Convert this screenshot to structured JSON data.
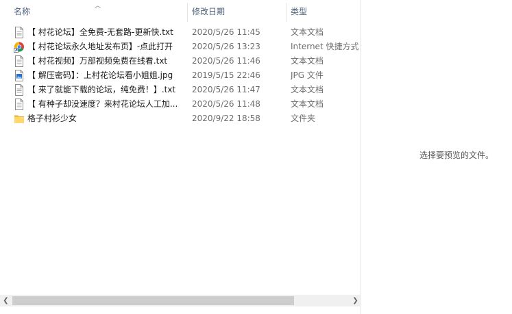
{
  "columns": {
    "name": "名称",
    "date": "修改日期",
    "type": "类型"
  },
  "files": [
    {
      "name": "【 村花论坛】全免费-无套路-更新快.txt",
      "date": "2020/5/26 11:45",
      "type": "文本文档",
      "icon": "text-file-icon"
    },
    {
      "name": "【 村花论坛永久地址发布页】-点此打开",
      "date": "2020/5/26 13:23",
      "type": "Internet 快捷方式",
      "icon": "internet-shortcut-icon"
    },
    {
      "name": "【 村花视频】万部视频免费在线看.txt",
      "date": "2020/5/26 11:46",
      "type": "文本文档",
      "icon": "text-file-icon"
    },
    {
      "name": "【 解压密码】：上村花论坛看小姐姐.jpg",
      "date": "2019/5/15 22:46",
      "type": "JPG 文件",
      "icon": "image-file-icon"
    },
    {
      "name": "【 来了就能下载的论坛，纯免费！】.txt",
      "date": "2020/5/26 11:47",
      "type": "文本文档",
      "icon": "text-file-icon"
    },
    {
      "name": "【 有种子却没速度？来村花论坛人工加...",
      "date": "2020/5/26 11:48",
      "type": "文本文档",
      "icon": "text-file-icon"
    },
    {
      "name": "格子村衫少女",
      "date": "2020/9/22 18:58",
      "type": "文件夹",
      "icon": "folder-icon"
    }
  ],
  "preview": {
    "message": "选择要预览的文件。"
  }
}
